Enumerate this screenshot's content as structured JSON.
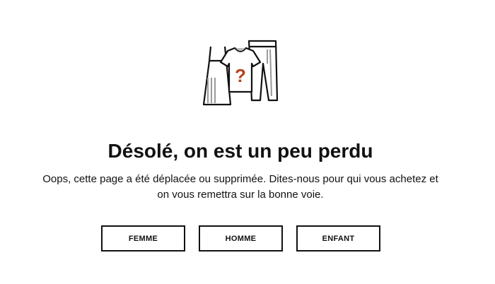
{
  "illustration": {
    "icon": "clothing-question-icon",
    "symbol": "?",
    "accent_color": "#b5421a"
  },
  "error": {
    "title": "Désolé, on est un peu perdu",
    "message_line1": "Oops, cette page a été déplacée ou supprimée. Dites-nous pour qui vous achetez et",
    "message_line2": "on vous remettra sur la bonne voie."
  },
  "buttons": {
    "femme": "FEMME",
    "homme": "HOMME",
    "enfant": "ENFANT"
  }
}
